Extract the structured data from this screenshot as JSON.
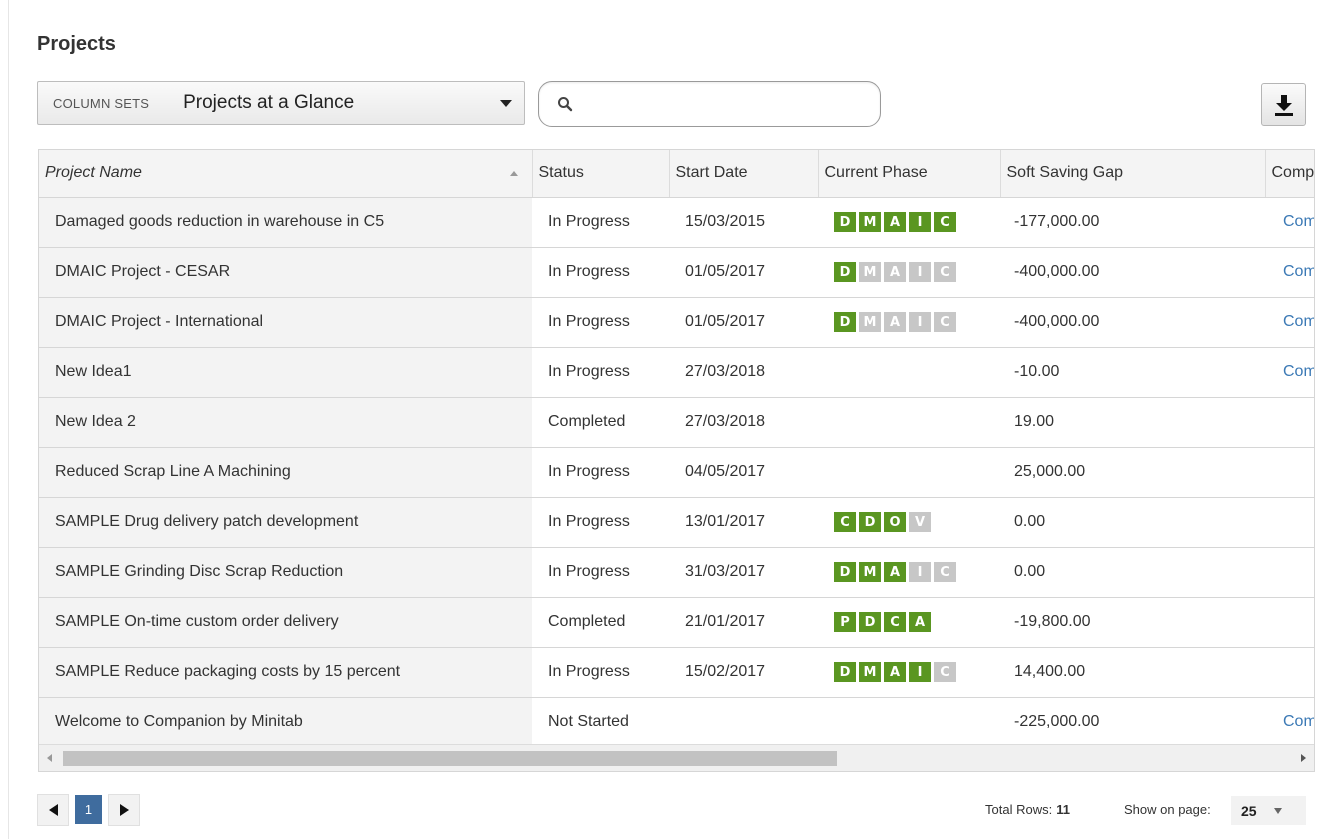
{
  "page": {
    "title": "Projects"
  },
  "toolbar": {
    "column_sets_label": "COLUMN SETS",
    "column_sets_value": "Projects at a Glance",
    "search_value": "",
    "search_placeholder": ""
  },
  "phase_colors": {
    "done": "#5a9621",
    "pending": "#c7c7c7"
  },
  "grid": {
    "columns": [
      "Project Name",
      "Status",
      "Start Date",
      "Current Phase",
      "Soft Saving Gap",
      "Comp"
    ],
    "rows": [
      {
        "name": "Damaged goods reduction in warehouse in C5",
        "status": "In Progress",
        "start": "15/03/2015",
        "phases": [
          {
            "l": "D",
            "on": true
          },
          {
            "l": "M",
            "on": true
          },
          {
            "l": "A",
            "on": true
          },
          {
            "l": "I",
            "on": true
          },
          {
            "l": "C",
            "on": true
          }
        ],
        "gap": "-177,000.00",
        "comp": "Com"
      },
      {
        "name": "DMAIC Project - CESAR",
        "status": "In Progress",
        "start": "01/05/2017",
        "phases": [
          {
            "l": "D",
            "on": true
          },
          {
            "l": "M",
            "on": false
          },
          {
            "l": "A",
            "on": false
          },
          {
            "l": "I",
            "on": false
          },
          {
            "l": "C",
            "on": false
          }
        ],
        "gap": "-400,000.00",
        "comp": "Com"
      },
      {
        "name": "DMAIC Project - International",
        "status": "In Progress",
        "start": "01/05/2017",
        "phases": [
          {
            "l": "D",
            "on": true
          },
          {
            "l": "M",
            "on": false
          },
          {
            "l": "A",
            "on": false
          },
          {
            "l": "I",
            "on": false
          },
          {
            "l": "C",
            "on": false
          }
        ],
        "gap": "-400,000.00",
        "comp": "Com"
      },
      {
        "name": "New Idea1",
        "status": "In Progress",
        "start": "27/03/2018",
        "phases": [],
        "gap": "-10.00",
        "comp": "Com"
      },
      {
        "name": "New Idea 2",
        "status": "Completed",
        "start": "27/03/2018",
        "phases": [],
        "gap": "19.00",
        "comp": ""
      },
      {
        "name": "Reduced Scrap Line A Machining",
        "status": "In Progress",
        "start": "04/05/2017",
        "phases": [],
        "gap": "25,000.00",
        "comp": ""
      },
      {
        "name": "SAMPLE Drug delivery patch development",
        "status": "In Progress",
        "start": "13/01/2017",
        "phases": [
          {
            "l": "C",
            "on": true
          },
          {
            "l": "D",
            "on": true
          },
          {
            "l": "O",
            "on": true
          },
          {
            "l": "V",
            "on": false
          }
        ],
        "gap": "0.00",
        "comp": ""
      },
      {
        "name": "SAMPLE Grinding Disc Scrap Reduction",
        "status": "In Progress",
        "start": "31/03/2017",
        "phases": [
          {
            "l": "D",
            "on": true
          },
          {
            "l": "M",
            "on": true
          },
          {
            "l": "A",
            "on": true
          },
          {
            "l": "I",
            "on": false
          },
          {
            "l": "C",
            "on": false
          }
        ],
        "gap": "0.00",
        "comp": ""
      },
      {
        "name": "SAMPLE On-time custom order delivery",
        "status": "Completed",
        "start": "21/01/2017",
        "phases": [
          {
            "l": "P",
            "on": true
          },
          {
            "l": "D",
            "on": true
          },
          {
            "l": "C",
            "on": true
          },
          {
            "l": "A",
            "on": true
          }
        ],
        "gap": "-19,800.00",
        "comp": ""
      },
      {
        "name": "SAMPLE Reduce packaging costs by 15 percent",
        "status": "In Progress",
        "start": "15/02/2017",
        "phases": [
          {
            "l": "D",
            "on": true
          },
          {
            "l": "M",
            "on": true
          },
          {
            "l": "A",
            "on": true
          },
          {
            "l": "I",
            "on": true
          },
          {
            "l": "C",
            "on": false
          }
        ],
        "gap": "14,400.00",
        "comp": ""
      },
      {
        "name": "Welcome to Companion by Minitab",
        "status": "Not Started",
        "start": "",
        "phases": [],
        "gap": "-225,000.00",
        "comp": "Com"
      }
    ]
  },
  "footer": {
    "current_page": "1",
    "total_rows_label": "Total Rows:",
    "total_rows": "11",
    "show_on_page_label": "Show on page:",
    "page_size": "25"
  }
}
